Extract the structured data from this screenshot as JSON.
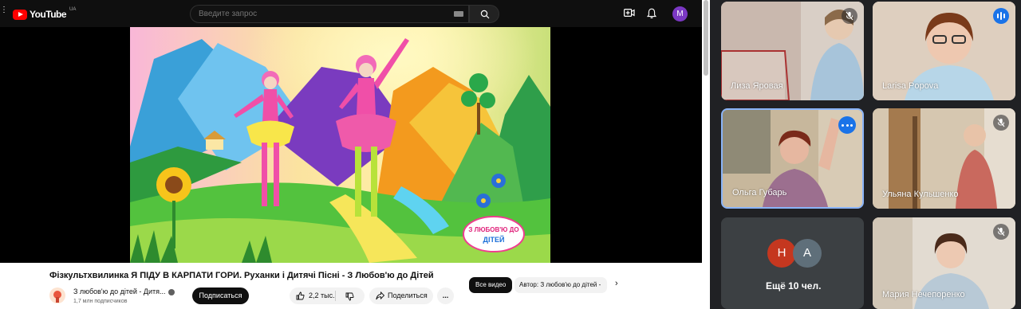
{
  "youtube": {
    "logo_text": "YouTube",
    "logo_country": "UA",
    "search_placeholder": "Введите запрос",
    "user_avatar_letter": "M",
    "video_title": "Фізкультхвилинка Я ПІДУ В КАРПАТИ ГОРИ. Руханки і Дитячі Пісні - З Любов'ю до Дітей",
    "channel_name": "З любов'ю до дітей - Дитя...",
    "subscribers": "1,7 млн подписчиков",
    "subscribe_label": "Подписаться",
    "likes_count": "2,2 тыс.",
    "share_label": "Поделиться",
    "more_label": "...",
    "chip_all_videos": "Все видео",
    "chip_author": "Автор: З любов'ю до дітей -",
    "chip_next": "›",
    "video_logo_line1": "З ЛЮБОВ'Ю ДО",
    "video_logo_line2": "ДІТЕЙ",
    "colors": {
      "brand_red": "#ff0000",
      "subscribe_bg": "#0f0f0f",
      "avatar_purple": "#7b38c4"
    }
  },
  "meet": {
    "participants": [
      {
        "name": "Лиза Яровая",
        "state": "muted"
      },
      {
        "name": "Larisa Popova",
        "state": "speaking"
      },
      {
        "name": "Ольга Губарь",
        "state": "options"
      },
      {
        "name": "Ульяна Кульшенко",
        "state": "muted"
      },
      {
        "name": "Мария Нечепоренко",
        "state": "muted"
      }
    ],
    "more": {
      "avatars": [
        "Н",
        "А"
      ],
      "label": "Ещё 10 чел.",
      "avatar_colors": [
        "#c5371f",
        "#5f6f7a"
      ]
    },
    "colors": {
      "active_border": "#8ab4f8",
      "accent_blue": "#1a73e8",
      "bg": "#202124"
    }
  }
}
